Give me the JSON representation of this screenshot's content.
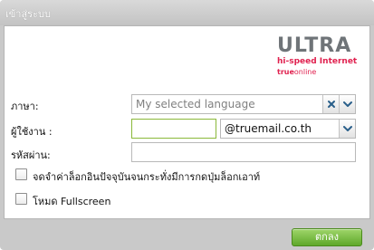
{
  "window": {
    "title": "เข้าสู่ระบบ"
  },
  "logo": {
    "brand": "ULTRA",
    "tagline": "hi-speed Internet",
    "provider_true": "true",
    "provider_online": "online"
  },
  "form": {
    "language": {
      "label": "ภาษา:",
      "placeholder": "My selected language",
      "clear_icon": "close-icon",
      "dropdown_icon": "chevron-down-icon"
    },
    "username": {
      "label": "ผู้ใช้งาน :",
      "value": "",
      "domain": "@truemail.co.th"
    },
    "password": {
      "label": "รหัสผ่าน:",
      "value": ""
    },
    "remember": {
      "label": "จดจำค่าล็อกอินปัจจุบันจนกระทั่งมีการกดปุ่มล็อกเอาท์",
      "checked": false
    },
    "fullscreen": {
      "label": "โหมด Fullscreen",
      "checked": false
    }
  },
  "actions": {
    "ok_label": "ตกลง"
  },
  "colors": {
    "accent_green": "#5ea82a",
    "brand_pink": "#e0214f",
    "username_border": "#8ab83a",
    "icon_blue": "#2a5f8a"
  }
}
